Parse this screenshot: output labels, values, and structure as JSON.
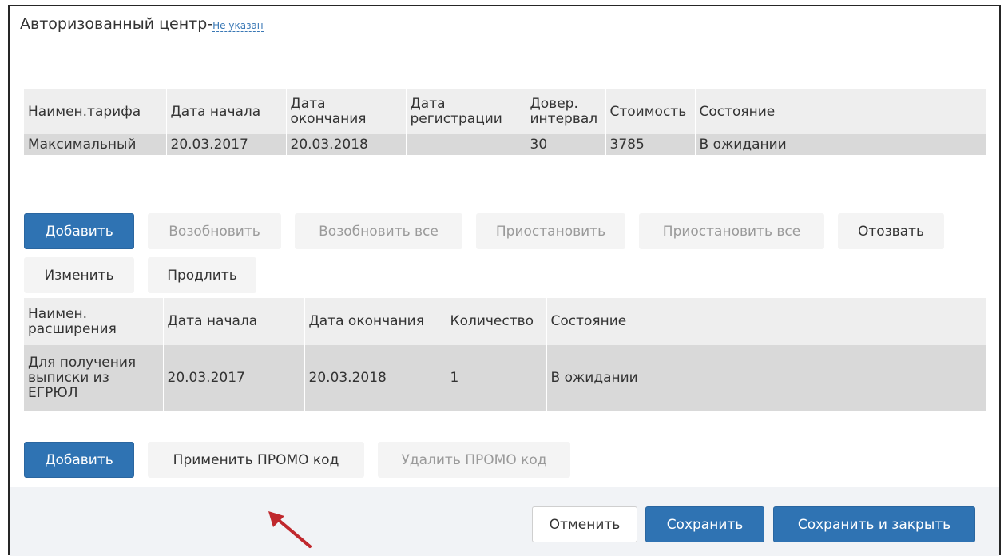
{
  "header": {
    "center_label": "Авторизованный центр-",
    "center_value": "Не указан"
  },
  "tariffs": {
    "columns": [
      "Наимен.тарифа",
      "Дата начала",
      "Дата окончания",
      "Дата регистрации",
      "Довер. интервал",
      "Стоимость",
      "Состояние"
    ],
    "rows": [
      [
        "Максимальный",
        "20.03.2017",
        "20.03.2018",
        "",
        "30",
        "3785",
        "В ожидании"
      ]
    ]
  },
  "tariff_actions": {
    "add": "Добавить",
    "renew": "Возобновить",
    "renew_all": "Возобновить все",
    "suspend": "Приостановить",
    "suspend_all": "Приостановить все",
    "revoke": "Отозвать",
    "edit": "Изменить",
    "extend": "Продлить"
  },
  "extensions": {
    "columns": [
      "Наимен. расширения",
      "Дата начала",
      "Дата окончания",
      "Количество",
      "Состояние"
    ],
    "rows": [
      [
        "Для получения выписки из ЕГРЮЛ",
        "20.03.2017",
        "20.03.2018",
        "1",
        "В ожидании"
      ]
    ]
  },
  "extension_actions": {
    "add": "Добавить",
    "apply_promo": "Применить ПРОМО код",
    "delete_promo": "Удалить ПРОМО код"
  },
  "footer": {
    "cancel": "Отменить",
    "save": "Сохранить",
    "save_close": "Сохранить и закрыть"
  },
  "colors": {
    "primary": "#2f73b3",
    "header_row": "#eeeeee",
    "data_row": "#d9d9d9",
    "annotation_arrow": "#c0282d"
  }
}
